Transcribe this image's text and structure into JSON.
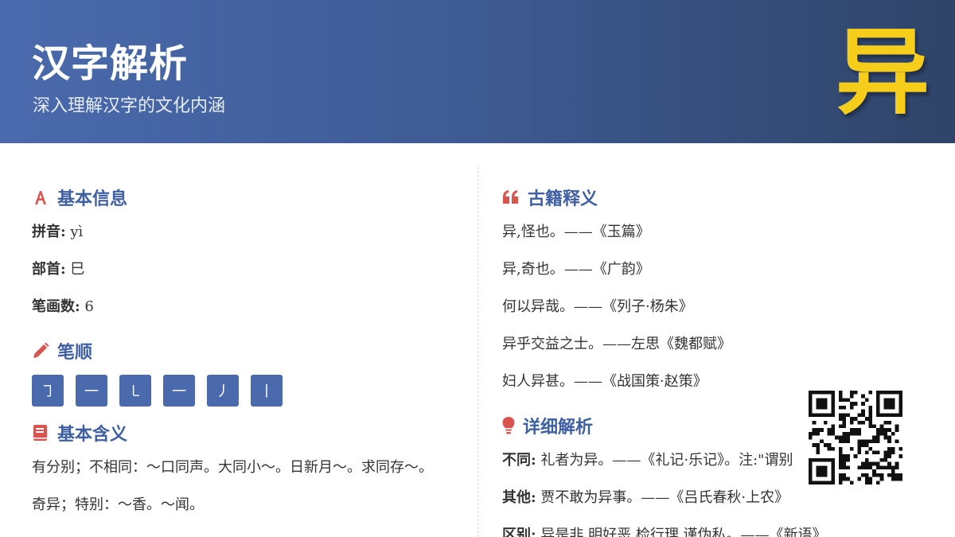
{
  "header": {
    "title": "汉字解析",
    "subtitle": "深入理解汉字的文化内涵",
    "character": "异"
  },
  "basic_info": {
    "section_title": "基本信息",
    "icon": "font-a-icon",
    "items": [
      {
        "label": "拼音:",
        "value": "yì"
      },
      {
        "label": "部首:",
        "value": "巳"
      },
      {
        "label": "笔画数:",
        "value": "6"
      }
    ]
  },
  "stroke_order": {
    "section_title": "笔顺",
    "icon": "pencil-icon",
    "strokes": [
      "㇆",
      "一",
      "㇄",
      "一",
      "丿",
      "丨"
    ]
  },
  "basic_meaning": {
    "section_title": "基本含义",
    "icon": "book-icon",
    "items": [
      "有分别；不相同：～口同声。大同小～。日新月～。求同存～。",
      "奇异；特别：～香。～闻。"
    ]
  },
  "classical": {
    "section_title": "古籍释义",
    "icon": "quote-icon",
    "items": [
      "异,怪也。——《玉篇》",
      "异,奇也。——《广韵》",
      "何以异哉。——《列子·杨朱》",
      "异乎交益之士。——左思《魏都赋》",
      "妇人异甚。——《战国策·赵策》"
    ]
  },
  "detailed": {
    "section_title": "详细解析",
    "icon": "lightbulb-icon",
    "items": [
      {
        "label": "不同:",
        "text": "礼者为异。——《礼记·乐记》。注:\"谓别"
      },
      {
        "label": "其他:",
        "text": "贾不敢为异事。——《吕氏春秋·上农》"
      },
      {
        "label": "区别:",
        "text": "异是非,明好恶,检行理,谨伪私。——《新语》"
      }
    ]
  },
  "colors": {
    "accent": "#3e5fa3",
    "icon_red": "#d9534f",
    "highlight_yellow": "#f6cd1b",
    "stroke_box": "#4a6aad"
  }
}
